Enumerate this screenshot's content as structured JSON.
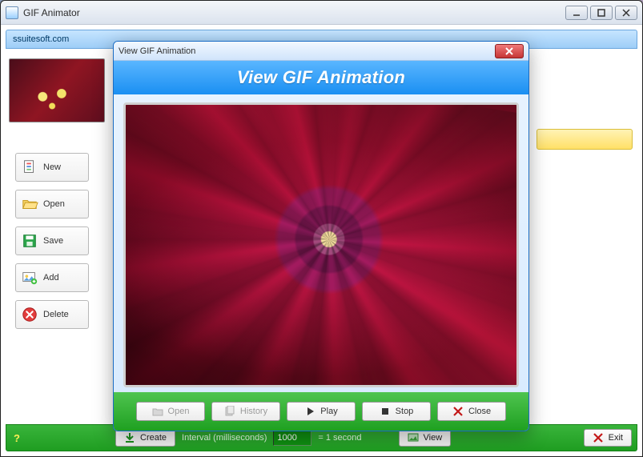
{
  "window": {
    "title": "GIF Animator"
  },
  "topbar": {
    "branding": "ssuitesoft.com"
  },
  "sidebar": {
    "buttons": [
      {
        "label": "New"
      },
      {
        "label": "Open"
      },
      {
        "label": "Save"
      },
      {
        "label": "Add"
      },
      {
        "label": "Delete"
      }
    ]
  },
  "footer": {
    "create_label": "Create",
    "interval_prefix": "Interval (milliseconds)",
    "interval_value": "1000",
    "interval_suffix": "= 1 second",
    "view_label": "View",
    "exit_label": "Exit",
    "help_symbol": "?"
  },
  "dialog": {
    "title": "View GIF Animation",
    "header": "View GIF Animation",
    "buttons": {
      "open": "Open",
      "history": "History",
      "play": "Play",
      "stop": "Stop",
      "close": "Close"
    }
  }
}
